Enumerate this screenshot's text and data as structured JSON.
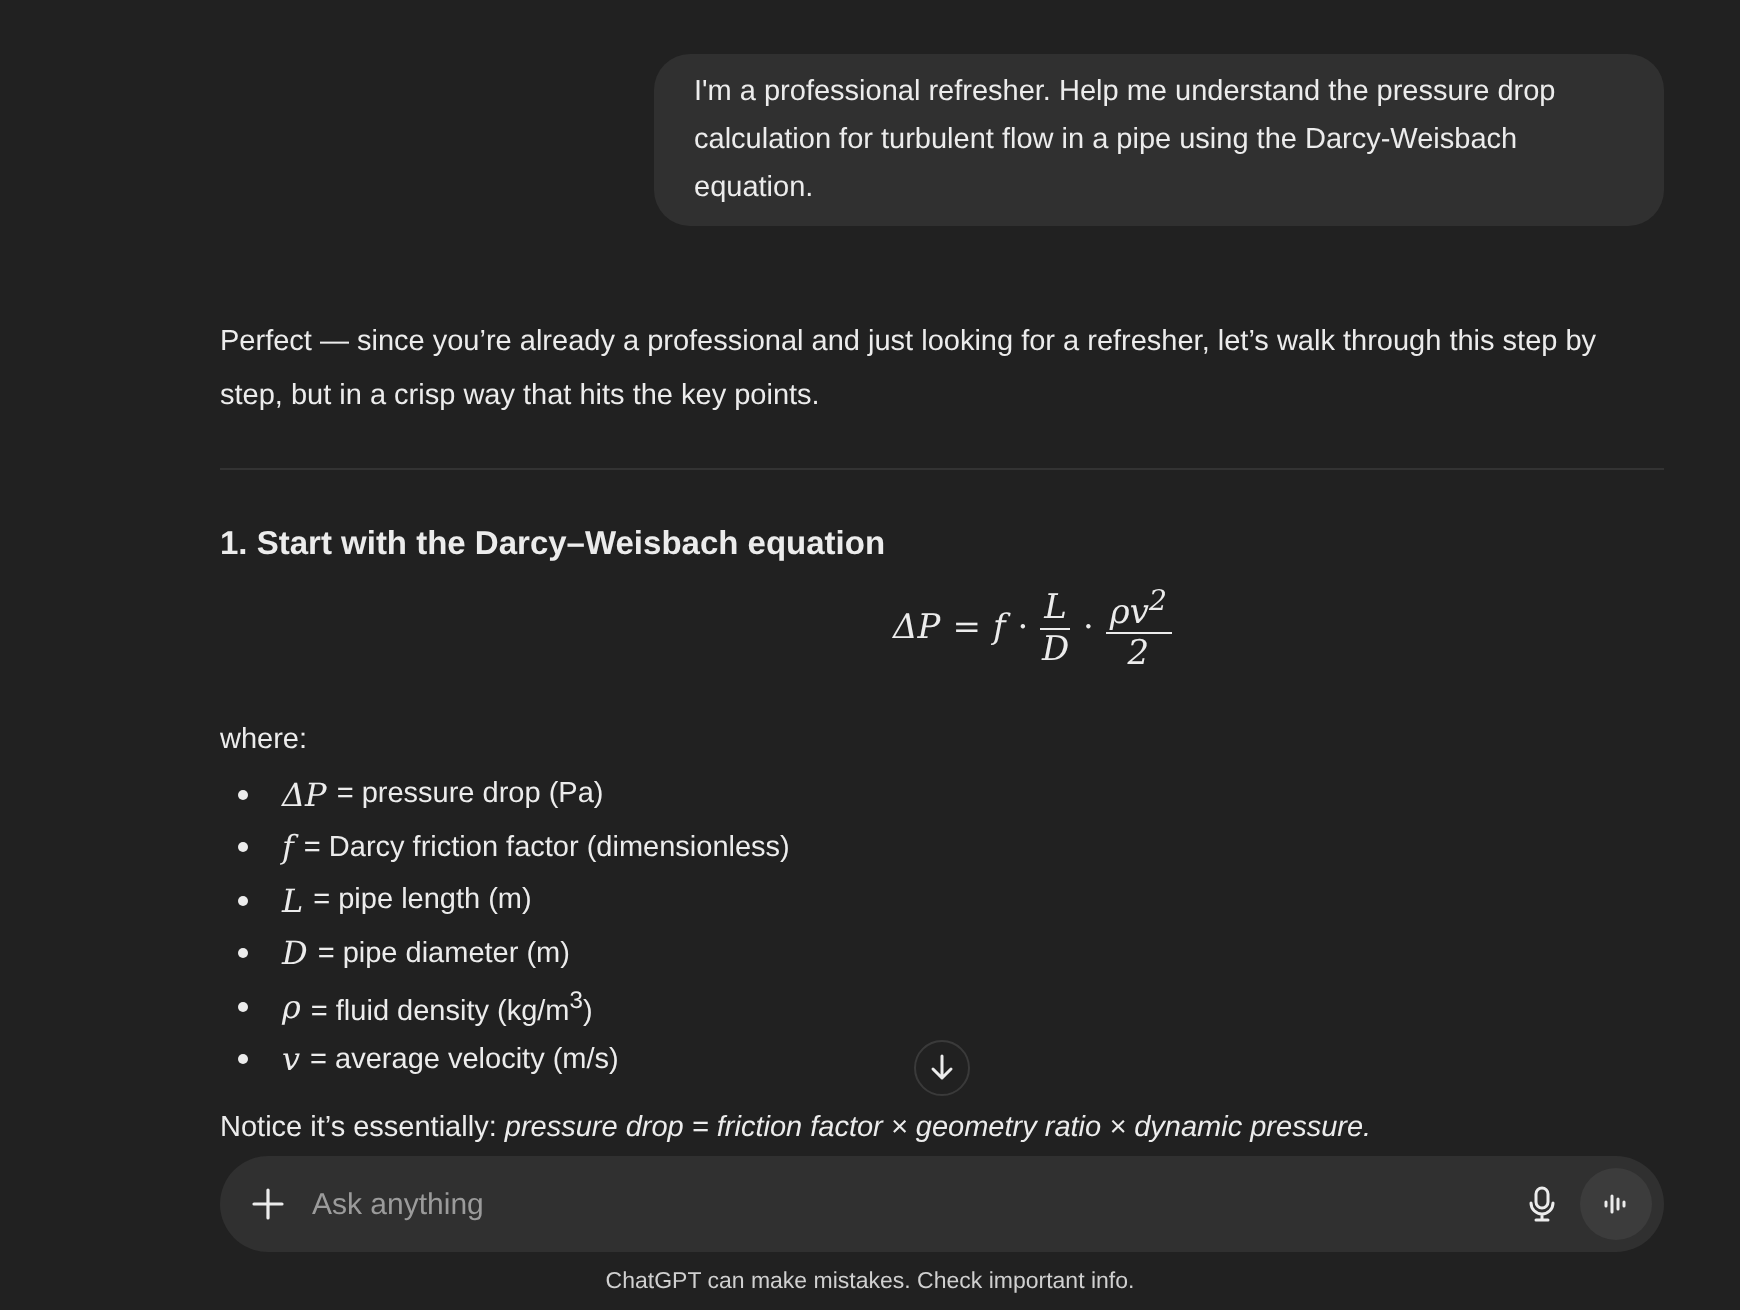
{
  "user_message": "I'm a professional refresher. Help me understand the pressure drop calculation for turbulent flow in a pipe using the Darcy-Weisbach equation.",
  "intro": "Perfect — since you’re already a professional and just looking for a refresher, let’s walk through this step by step, but in a crisp way that hits the key points.",
  "heading": "1. Start with the Darcy–Weisbach equation",
  "equation": [
    {
      "kind": "sym",
      "text": "ΔP"
    },
    {
      "kind": "op",
      "text": "="
    },
    {
      "kind": "sym",
      "text": "f"
    },
    {
      "kind": "op",
      "text": "·"
    },
    {
      "kind": "frac",
      "num": "L",
      "den": "D"
    },
    {
      "kind": "op",
      "text": "·"
    },
    {
      "kind": "frac",
      "num": "ρv$^{2}$",
      "den": "2"
    }
  ],
  "where_label": "where:",
  "variables": [
    {
      "symbol": "ΔP",
      "meaning": "= pressure drop (Pa)"
    },
    {
      "symbol": "f",
      "meaning": "= Darcy friction factor (dimensionless)"
    },
    {
      "symbol": "L",
      "meaning": "= pipe length (m)"
    },
    {
      "symbol": "D",
      "meaning": "= pipe diameter (m)"
    },
    {
      "symbol": "ρ",
      "meaning": "= fluid density (kg/m$^{3}$)"
    },
    {
      "symbol": "v",
      "meaning": "= average velocity (m/s)"
    }
  ],
  "summary": "Notice it’s essentially: *pressure drop = friction factor × geometry ratio × dynamic pressure.*",
  "composer": {
    "placeholder": "Ask anything"
  },
  "disclaimer": "ChatGPT can make mistakes. Check important info."
}
